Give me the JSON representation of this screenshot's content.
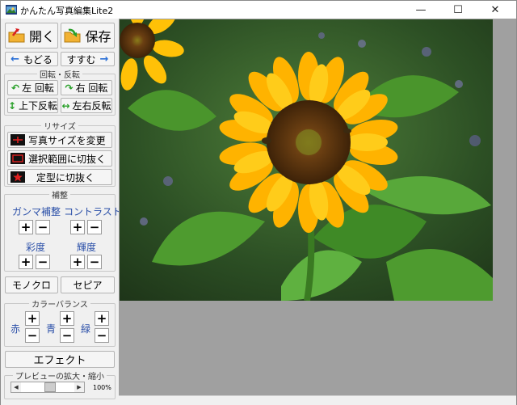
{
  "window": {
    "title": "かんたん写真編集Lite2",
    "minimize": "—",
    "maximize": "☐",
    "close": "✕"
  },
  "file": {
    "open_label": "開く",
    "save_label": "保存"
  },
  "history": {
    "back_label": "もどる",
    "forward_label": "すすむ"
  },
  "rotate": {
    "title": "回転・反転",
    "rotate_left": "左 回転",
    "rotate_right": "右 回転",
    "flip_vertical": "上下反転",
    "flip_horizontal": "左右反転"
  },
  "resize": {
    "title": "リサイズ",
    "change_size": "写真サイズを変更",
    "crop_selection": "選択範囲に切抜く",
    "crop_shape": "定型に切抜く"
  },
  "correction": {
    "title": "補整",
    "gamma": "ガンマ補整",
    "contrast": "コントラスト",
    "saturation": "彩度",
    "brightness": "輝度",
    "plus": "+",
    "minus": "−"
  },
  "tone": {
    "mono": "モノクロ",
    "sepia": "セピア"
  },
  "color_balance": {
    "title": "カラーバランス",
    "red": "赤",
    "blue": "青",
    "green": "緑"
  },
  "effect": {
    "label": "エフェクト"
  },
  "preview": {
    "title": "プレビューの拡大・縮小",
    "zoom": "100%",
    "zoom_fraction": 0.55
  },
  "colors": {
    "accent": "#2a6fd6",
    "label_blue": "#2a4fa8",
    "canvas_bg": "#a0a0a0"
  }
}
